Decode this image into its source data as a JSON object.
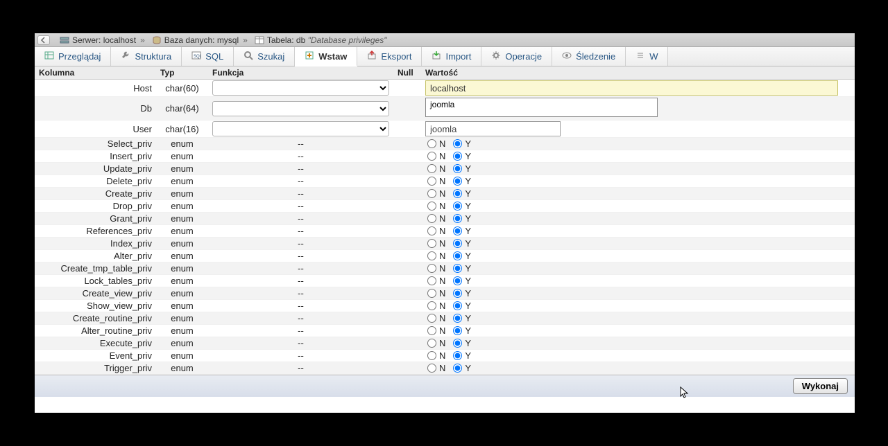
{
  "breadcrumb": {
    "server_label": "Serwer:",
    "server_value": "localhost",
    "db_label": "Baza danych:",
    "db_value": "mysql",
    "table_label": "Tabela:",
    "table_value": "db",
    "quoted": "\"Database privileges\""
  },
  "tabs": [
    {
      "id": "browse",
      "label": "Przeglądaj",
      "icon": "table"
    },
    {
      "id": "structure",
      "label": "Struktura",
      "icon": "wrench"
    },
    {
      "id": "sql",
      "label": "SQL",
      "icon": "sql"
    },
    {
      "id": "search",
      "label": "Szukaj",
      "icon": "search"
    },
    {
      "id": "insert",
      "label": "Wstaw",
      "icon": "insert",
      "active": true
    },
    {
      "id": "export",
      "label": "Eksport",
      "icon": "export"
    },
    {
      "id": "import",
      "label": "Import",
      "icon": "import"
    },
    {
      "id": "operations",
      "label": "Operacje",
      "icon": "gear"
    },
    {
      "id": "tracking",
      "label": "Śledzenie",
      "icon": "eye"
    },
    {
      "id": "more",
      "label": "W",
      "icon": "more"
    }
  ],
  "headers": {
    "kolumna": "Kolumna",
    "typ": "Typ",
    "funkcja": "Funkcja",
    "null": "Null",
    "wartosc": "Wartość"
  },
  "rows": [
    {
      "name": "Host",
      "type": "char(60)",
      "kind": "host",
      "value": "localhost"
    },
    {
      "name": "Db",
      "type": "char(64)",
      "kind": "db",
      "value": "joomla"
    },
    {
      "name": "User",
      "type": "char(16)",
      "kind": "user",
      "value": "joomla"
    },
    {
      "name": "Select_priv",
      "type": "enum",
      "kind": "enum"
    },
    {
      "name": "Insert_priv",
      "type": "enum",
      "kind": "enum"
    },
    {
      "name": "Update_priv",
      "type": "enum",
      "kind": "enum"
    },
    {
      "name": "Delete_priv",
      "type": "enum",
      "kind": "enum"
    },
    {
      "name": "Create_priv",
      "type": "enum",
      "kind": "enum"
    },
    {
      "name": "Drop_priv",
      "type": "enum",
      "kind": "enum"
    },
    {
      "name": "Grant_priv",
      "type": "enum",
      "kind": "enum"
    },
    {
      "name": "References_priv",
      "type": "enum",
      "kind": "enum"
    },
    {
      "name": "Index_priv",
      "type": "enum",
      "kind": "enum"
    },
    {
      "name": "Alter_priv",
      "type": "enum",
      "kind": "enum"
    },
    {
      "name": "Create_tmp_table_priv",
      "type": "enum",
      "kind": "enum"
    },
    {
      "name": "Lock_tables_priv",
      "type": "enum",
      "kind": "enum"
    },
    {
      "name": "Create_view_priv",
      "type": "enum",
      "kind": "enum"
    },
    {
      "name": "Show_view_priv",
      "type": "enum",
      "kind": "enum"
    },
    {
      "name": "Create_routine_priv",
      "type": "enum",
      "kind": "enum"
    },
    {
      "name": "Alter_routine_priv",
      "type": "enum",
      "kind": "enum"
    },
    {
      "name": "Execute_priv",
      "type": "enum",
      "kind": "enum"
    },
    {
      "name": "Event_priv",
      "type": "enum",
      "kind": "enum"
    },
    {
      "name": "Trigger_priv",
      "type": "enum",
      "kind": "enum"
    }
  ],
  "enum_labels": {
    "n": "N",
    "y": "Y"
  },
  "enum_dash": "--",
  "footer": {
    "execute": "Wykonaj"
  }
}
